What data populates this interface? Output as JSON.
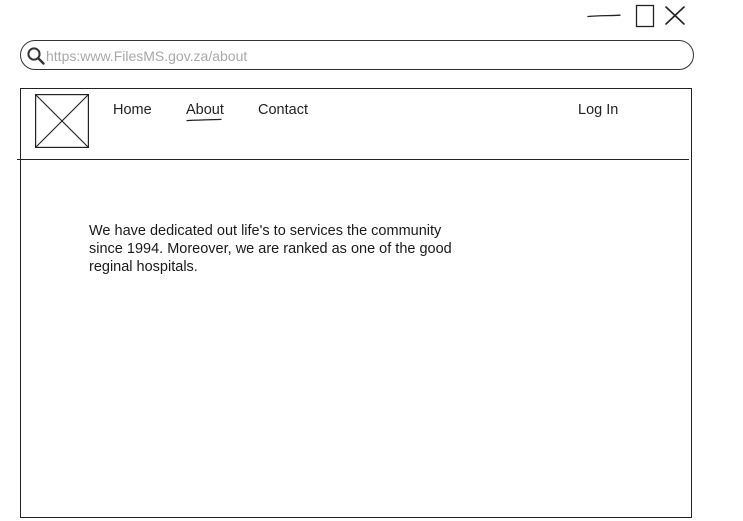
{
  "window": {
    "minimize_icon": "minimize-icon",
    "maximize_icon": "maximize-icon",
    "close_icon": "close-icon"
  },
  "address_bar": {
    "icon": "search-icon",
    "placeholder": "https:www.FilesMS.gov.za/about",
    "value": ""
  },
  "header": {
    "logo": "image-placeholder-icon",
    "nav": {
      "home": "Home",
      "about": "About",
      "contact": "Contact",
      "active": "about"
    },
    "login": "Log In"
  },
  "main": {
    "about_text": "We have dedicated out life's to services the community since 1994. Moreover, we are ranked as one of the good reginal hospitals."
  },
  "colors": {
    "stroke": "#222222",
    "placeholder_text": "#a8a8a8",
    "background": "#ffffff"
  }
}
